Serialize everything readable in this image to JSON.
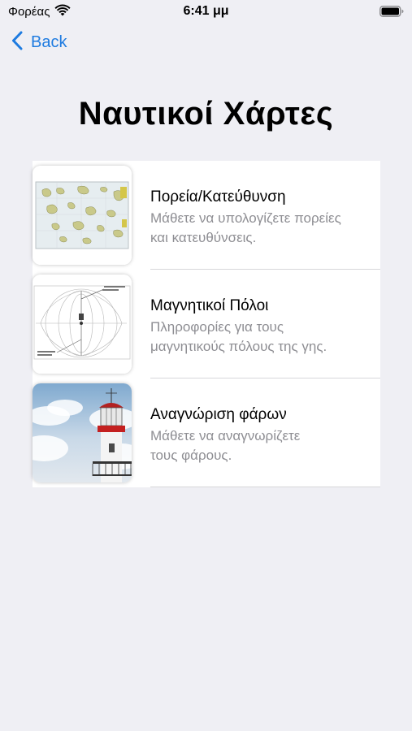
{
  "status_bar": {
    "carrier": "Φορέας",
    "time": "6:41 μμ",
    "wifi_icon": "wifi-icon",
    "battery_icon": "battery-icon"
  },
  "nav": {
    "back_label": "Back",
    "back_icon": "chevron-left-icon",
    "accent_color": "#1e7be0"
  },
  "page": {
    "title": "Ναυτικοί Χάρτες"
  },
  "menu": {
    "items": [
      {
        "title": "Πορεία/Κατεύθυνση",
        "subtitle": "Μάθετε να υπολογίζετε πορείες\nκαι κατευθύνσεις.",
        "thumbnail": "nautical-chart-thumbnail"
      },
      {
        "title": "Μαγνητικοί Πόλοι",
        "subtitle": "Πληροφορίες για τους\nμαγνητικούς πόλους της γης.",
        "thumbnail": "magnetic-field-diagram-thumbnail"
      },
      {
        "title": "Αναγνώριση φάρων",
        "subtitle": "Μάθετε να αναγνωρίζετε\nτους φάρους.",
        "thumbnail": "lighthouse-photo-thumbnail"
      }
    ]
  }
}
